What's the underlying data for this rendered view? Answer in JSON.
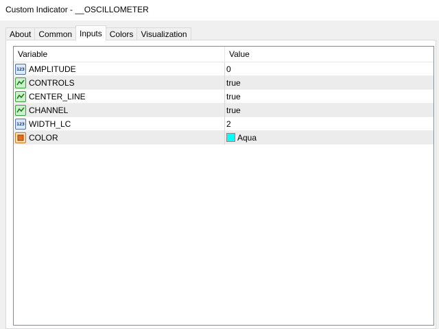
{
  "window": {
    "title": "Custom Indicator - __OSCILLOMETER"
  },
  "tabs": [
    {
      "label": "About"
    },
    {
      "label": "Common"
    },
    {
      "label": "Inputs",
      "active": true
    },
    {
      "label": "Colors"
    },
    {
      "label": "Visualization"
    }
  ],
  "grid": {
    "columns": {
      "variable": "Variable",
      "value": "Value"
    },
    "rows": [
      {
        "name": "AMPLITUDE",
        "value": "0",
        "icon": "number-type-icon"
      },
      {
        "name": "CONTROLS",
        "value": "true",
        "icon": "boolean-type-icon"
      },
      {
        "name": "CENTER_LINE",
        "value": "true",
        "icon": "boolean-type-icon"
      },
      {
        "name": "CHANNEL",
        "value": "true",
        "icon": "boolean-type-icon"
      },
      {
        "name": "WIDTH_LC",
        "value": "2",
        "icon": "number-type-icon"
      },
      {
        "name": "COLOR",
        "value": "Aqua",
        "icon": "color-type-icon",
        "swatch": "#00ffff"
      }
    ]
  },
  "icons": {
    "number_glyph": "123"
  }
}
